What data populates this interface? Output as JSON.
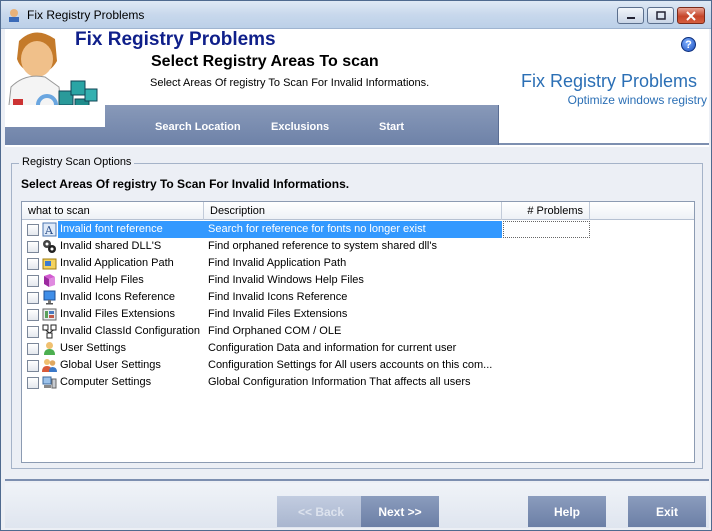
{
  "window": {
    "title": "Fix Registry Problems"
  },
  "header": {
    "app_name": "Fix Registry Problems",
    "page_title": "Select Registry Areas To scan",
    "page_subtitle": "Select Areas Of registry To Scan For Invalid Informations.",
    "brand_title": "Fix Registry Problems",
    "brand_subtitle": "Optimize windows registry",
    "help_glyph": "?"
  },
  "tabs": [
    {
      "label": "Search Location"
    },
    {
      "label": "Exclusions"
    },
    {
      "label": "Start"
    }
  ],
  "group": {
    "legend": "Registry Scan Options",
    "instruction": "Select Areas Of registry To Scan For Invalid Informations."
  },
  "list": {
    "columns": [
      "what to scan",
      "Description",
      "# Problems"
    ],
    "rows": [
      {
        "name": "Invalid font reference",
        "desc": "Search for reference for fonts no longer exist",
        "icon": "font-icon",
        "selected": true
      },
      {
        "name": "Invalid shared DLL'S",
        "desc": "Find orphaned reference to system shared dll's",
        "icon": "gears-icon"
      },
      {
        "name": "Invalid Application Path",
        "desc": "Find Invalid Application Path",
        "icon": "folder-app-icon"
      },
      {
        "name": "Invalid Help Files",
        "desc": "Find Invalid Windows Help Files",
        "icon": "help-book-icon"
      },
      {
        "name": "Invalid Icons Reference",
        "desc": "Find Invalid Icons Reference",
        "icon": "monitor-icon"
      },
      {
        "name": "Invalid Files Extensions",
        "desc": "Find Invalid Files Extensions",
        "icon": "file-ext-icon"
      },
      {
        "name": "Invalid ClassId Configuration",
        "desc": "Find Orphaned COM / OLE",
        "icon": "network-icon"
      },
      {
        "name": "User Settings",
        "desc": "Configuration Data and information for current user",
        "icon": "user-icon"
      },
      {
        "name": "Global User Settings",
        "desc": "Configuration Settings for All users accounts on this com...",
        "icon": "users-icon"
      },
      {
        "name": "Computer Settings",
        "desc": "Global Configuration Information That affects all users",
        "icon": "computer-icon"
      }
    ]
  },
  "buttons": {
    "back": "<< Back",
    "next": "Next >>",
    "help": "Help",
    "exit": "Exit"
  },
  "colors": {
    "accent": "#6e82a8",
    "brand": "#2b6fb5",
    "title_blue": "#0f1f8a",
    "selection": "#3399ff"
  }
}
